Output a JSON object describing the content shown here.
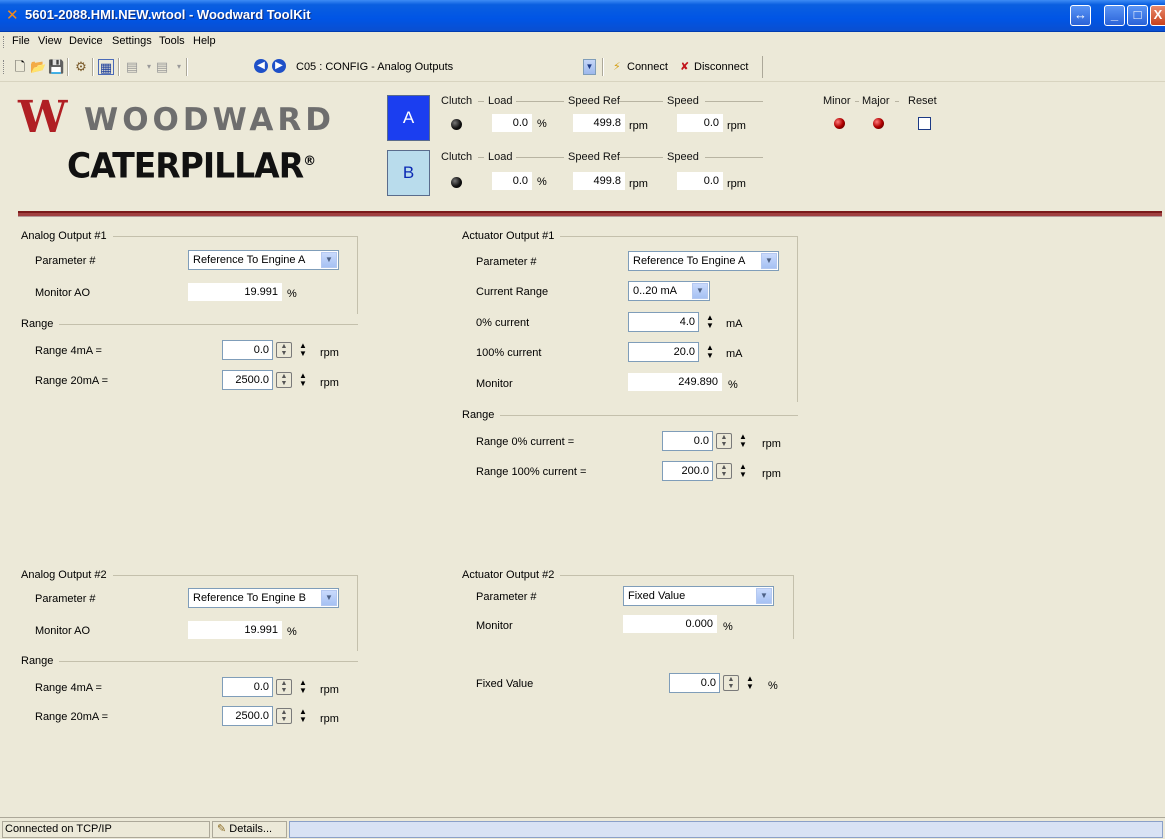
{
  "window": {
    "title": "5601-2088.HMI.NEW.wtool - Woodward ToolKit"
  },
  "menu": [
    "File",
    "View",
    "Device",
    "Settings",
    "Tools",
    "Help"
  ],
  "toolbar": {
    "page_selector": "C05 : CONFIG - Analog Outputs",
    "connect_label": "Connect",
    "disconnect_label": "Disconnect"
  },
  "header": {
    "woodward_logo_text": "WOODWARD",
    "cat_logo_text": "CATERPILLAR",
    "engines": [
      {
        "button": "A",
        "clutch_label": "Clutch",
        "load_label": "Load",
        "load_value": "0.0",
        "load_unit": "%",
        "speedref_label": "Speed Ref",
        "speedref_value": "499.8",
        "speedref_unit": "rpm",
        "speed_label": "Speed",
        "speed_value": "0.0",
        "speed_unit": "rpm"
      },
      {
        "button": "B",
        "clutch_label": "Clutch",
        "load_label": "Load",
        "load_value": "0.0",
        "load_unit": "%",
        "speedref_label": "Speed Ref",
        "speedref_value": "499.8",
        "speedref_unit": "rpm",
        "speed_label": "Speed",
        "speed_value": "0.0",
        "speed_unit": "rpm"
      }
    ],
    "alarms": {
      "minor_label": "Minor",
      "major_label": "Major",
      "reset_label": "Reset"
    }
  },
  "analog_output_1": {
    "title": "Analog Output #1",
    "param_label": "Parameter #",
    "param_value": "Reference To Engine A",
    "monitor_label": "Monitor AO",
    "monitor_value": "19.991",
    "monitor_unit": "%",
    "range_title": "Range",
    "range4_label": "Range 4mA =",
    "range4_value": "0.0",
    "range20_label": "Range 20mA =",
    "range20_value": "2500.0",
    "unit": "rpm"
  },
  "analog_output_2": {
    "title": "Analog Output #2",
    "param_label": "Parameter #",
    "param_value": "Reference To Engine B",
    "monitor_label": "Monitor AO",
    "monitor_value": "19.991",
    "monitor_unit": "%",
    "range_title": "Range",
    "range4_label": "Range 4mA =",
    "range4_value": "0.0",
    "range20_label": "Range 20mA =",
    "range20_value": "2500.0",
    "unit": "rpm"
  },
  "actuator_output_1": {
    "title": "Actuator Output #1",
    "param_label": "Parameter #",
    "param_value": "Reference To Engine A",
    "current_range_label": "Current Range",
    "current_range_value": "0..20 mA",
    "zero_current_label": "0% current",
    "zero_current_value": "4.0",
    "full_current_label": "100% current",
    "full_current_value": "20.0",
    "current_unit": "mA",
    "monitor_label": "Monitor",
    "monitor_value": "249.890",
    "monitor_unit": "%",
    "range_title": "Range",
    "range0_label": "Range 0% current =",
    "range0_value": "0.0",
    "range100_label": "Range 100% current =",
    "range100_value": "200.0",
    "range_unit": "rpm"
  },
  "actuator_output_2": {
    "title": "Actuator Output #2",
    "param_label": "Parameter #",
    "param_value": "Fixed Value",
    "monitor_label": "Monitor",
    "monitor_value": "0.000",
    "monitor_unit": "%",
    "fixed_label": "Fixed Value",
    "fixed_value": "0.0",
    "fixed_unit": "%"
  },
  "status": {
    "connection": "Connected on TCP/IP",
    "details_label": "Details..."
  }
}
